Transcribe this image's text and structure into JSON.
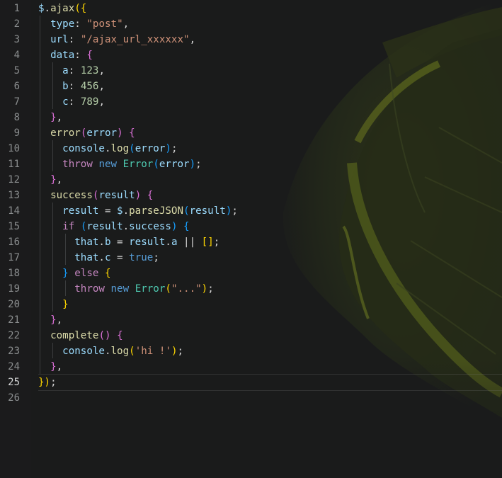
{
  "editor": {
    "line_numbers": [
      "1",
      "2",
      "3",
      "4",
      "5",
      "6",
      "7",
      "8",
      "9",
      "10",
      "11",
      "12",
      "13",
      "14",
      "15",
      "16",
      "17",
      "18",
      "19",
      "20",
      "21",
      "22",
      "23",
      "24",
      "25",
      "26"
    ],
    "active_line": "25",
    "code_lines": [
      [
        [
          "$",
          "t-var"
        ],
        [
          ".",
          "t-pu"
        ],
        [
          "ajax",
          "t-fn"
        ],
        [
          "({",
          "t-b1"
        ]
      ],
      [
        [
          "  "
        ],
        [
          "type",
          "t-var"
        ],
        [
          ": ",
          "t-pu"
        ],
        [
          "\"post\"",
          "t-str"
        ],
        [
          ",",
          "t-pu"
        ]
      ],
      [
        [
          "  "
        ],
        [
          "url",
          "t-var"
        ],
        [
          ": ",
          "t-pu"
        ],
        [
          "\"/ajax_url_xxxxxx\"",
          "t-str"
        ],
        [
          ",",
          "t-pu"
        ]
      ],
      [
        [
          "  "
        ],
        [
          "data",
          "t-var"
        ],
        [
          ": ",
          "t-pu"
        ],
        [
          "{",
          "t-b2"
        ]
      ],
      [
        [
          "    "
        ],
        [
          "a",
          "t-var"
        ],
        [
          ": ",
          "t-pu"
        ],
        [
          "123",
          "t-num"
        ],
        [
          ",",
          "t-pu"
        ]
      ],
      [
        [
          "    "
        ],
        [
          "b",
          "t-var"
        ],
        [
          ": ",
          "t-pu"
        ],
        [
          "456",
          "t-num"
        ],
        [
          ",",
          "t-pu"
        ]
      ],
      [
        [
          "    "
        ],
        [
          "c",
          "t-var"
        ],
        [
          ": ",
          "t-pu"
        ],
        [
          "789",
          "t-num"
        ],
        [
          ",",
          "t-pu"
        ]
      ],
      [
        [
          "  "
        ],
        [
          "}",
          "t-b2"
        ],
        [
          ",",
          "t-pu"
        ]
      ],
      [
        [
          "  "
        ],
        [
          "error",
          "t-fn"
        ],
        [
          "(",
          "t-b2"
        ],
        [
          "error",
          "t-var"
        ],
        [
          ")",
          "t-b2"
        ],
        [
          " "
        ],
        [
          "{",
          "t-b2"
        ]
      ],
      [
        [
          "    "
        ],
        [
          "console",
          "t-var"
        ],
        [
          ".",
          "t-pu"
        ],
        [
          "log",
          "t-fn"
        ],
        [
          "(",
          "t-b3"
        ],
        [
          "error",
          "t-var"
        ],
        [
          ")",
          "t-b3"
        ],
        [
          ";",
          "t-pu"
        ]
      ],
      [
        [
          "    "
        ],
        [
          "throw",
          "t-ctrl"
        ],
        [
          " "
        ],
        [
          "new",
          "t-kw"
        ],
        [
          " "
        ],
        [
          "Error",
          "t-cls"
        ],
        [
          "(",
          "t-b3"
        ],
        [
          "error",
          "t-var"
        ],
        [
          ")",
          "t-b3"
        ],
        [
          ";",
          "t-pu"
        ]
      ],
      [
        [
          "  "
        ],
        [
          "}",
          "t-b2"
        ],
        [
          ",",
          "t-pu"
        ]
      ],
      [
        [
          "  "
        ],
        [
          "success",
          "t-fn"
        ],
        [
          "(",
          "t-b2"
        ],
        [
          "result",
          "t-var"
        ],
        [
          ")",
          "t-b2"
        ],
        [
          " "
        ],
        [
          "{",
          "t-b2"
        ]
      ],
      [
        [
          "    "
        ],
        [
          "result",
          "t-var"
        ],
        [
          " = ",
          "t-pu"
        ],
        [
          "$",
          "t-var"
        ],
        [
          ".",
          "t-pu"
        ],
        [
          "parseJSON",
          "t-fn"
        ],
        [
          "(",
          "t-b3"
        ],
        [
          "result",
          "t-var"
        ],
        [
          ")",
          "t-b3"
        ],
        [
          ";",
          "t-pu"
        ]
      ],
      [
        [
          "    "
        ],
        [
          "if",
          "t-ctrl"
        ],
        [
          " "
        ],
        [
          "(",
          "t-b3"
        ],
        [
          "result",
          "t-var"
        ],
        [
          ".",
          "t-pu"
        ],
        [
          "success",
          "t-var"
        ],
        [
          ")",
          "t-b3"
        ],
        [
          " "
        ],
        [
          "{",
          "t-b3"
        ]
      ],
      [
        [
          "      "
        ],
        [
          "that",
          "t-var"
        ],
        [
          ".",
          "t-pu"
        ],
        [
          "b",
          "t-var"
        ],
        [
          " = ",
          "t-pu"
        ],
        [
          "result",
          "t-var"
        ],
        [
          ".",
          "t-pu"
        ],
        [
          "a",
          "t-var"
        ],
        [
          " || ",
          "t-pu"
        ],
        [
          "[]",
          "t-b1"
        ],
        [
          ";",
          "t-pu"
        ]
      ],
      [
        [
          "      "
        ],
        [
          "that",
          "t-var"
        ],
        [
          ".",
          "t-pu"
        ],
        [
          "c",
          "t-var"
        ],
        [
          " = ",
          "t-pu"
        ],
        [
          "true",
          "t-kw"
        ],
        [
          ";",
          "t-pu"
        ]
      ],
      [
        [
          "    "
        ],
        [
          "}",
          "t-b3"
        ],
        [
          " "
        ],
        [
          "else",
          "t-ctrl"
        ],
        [
          " "
        ],
        [
          "{",
          "t-b1"
        ]
      ],
      [
        [
          "      "
        ],
        [
          "throw",
          "t-ctrl"
        ],
        [
          " "
        ],
        [
          "new",
          "t-kw"
        ],
        [
          " "
        ],
        [
          "Error",
          "t-cls"
        ],
        [
          "(",
          "t-b1"
        ],
        [
          "\"...\"",
          "t-str"
        ],
        [
          ")",
          "t-b1"
        ],
        [
          ";",
          "t-pu"
        ]
      ],
      [
        [
          "    "
        ],
        [
          "}",
          "t-b1"
        ]
      ],
      [
        [
          "  "
        ],
        [
          "}",
          "t-b2"
        ],
        [
          ",",
          "t-pu"
        ]
      ],
      [
        [
          "  "
        ],
        [
          "complete",
          "t-fn"
        ],
        [
          "()",
          "t-b2"
        ],
        [
          " "
        ],
        [
          "{",
          "t-b2"
        ]
      ],
      [
        [
          "    "
        ],
        [
          "console",
          "t-var"
        ],
        [
          ".",
          "t-pu"
        ],
        [
          "log",
          "t-fn"
        ],
        [
          "(",
          "t-b1"
        ],
        [
          "'hi !'",
          "t-str"
        ],
        [
          ")",
          "t-b1"
        ],
        [
          ";",
          "t-pu"
        ]
      ],
      [
        [
          "  "
        ],
        [
          "}",
          "t-b2"
        ],
        [
          ",",
          "t-pu"
        ]
      ],
      [
        [
          "})",
          "t-b1"
        ],
        [
          ";",
          "t-pu"
        ]
      ],
      []
    ]
  },
  "colors": {
    "background": "#1a1b1b",
    "lime_accent": "#6d7a1f",
    "line_number": "#8a8d8e",
    "active_line_number": "#d4d6d6"
  }
}
